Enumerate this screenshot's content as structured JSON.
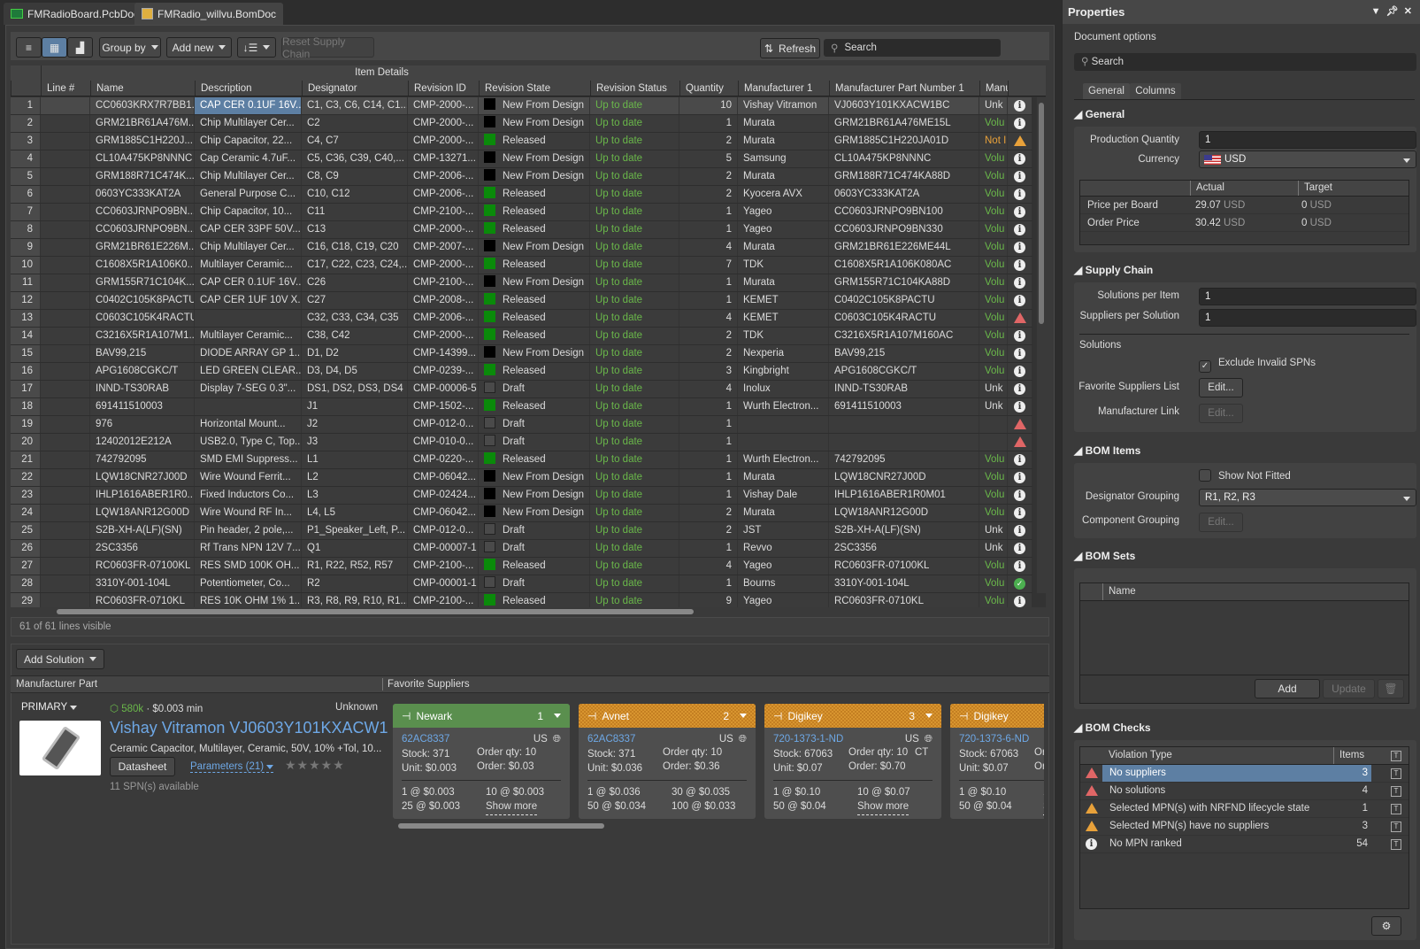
{
  "tabs": [
    {
      "label": "FMRadioBoard.PcbDoc",
      "icon": "pcb-icon"
    },
    {
      "label": "FMRadio_willvu.BomDoc",
      "icon": "bom-doc-icon"
    }
  ],
  "toolbar": {
    "group_by": "Group by",
    "add_new": "Add new",
    "reset_supply_chain": "Reset Supply Chain",
    "refresh": "Refresh",
    "search_placeholder": "Search"
  },
  "grid": {
    "group_header": "Item Details",
    "columns": [
      "",
      "Line #",
      "Name",
      "Description",
      "Designator",
      "Revision ID",
      "Revision State",
      "Revision Status",
      "Quantity",
      "Manufacturer 1",
      "Manufacturer Part Number 1",
      "Manu",
      ""
    ],
    "status_colors": {
      "new": "#000000",
      "released": "#0a8a0a",
      "draft": "#4a4a4a"
    },
    "rows": [
      {
        "n": "1",
        "name": "CC0603KRX7R7BB1...",
        "desc": "CAP CER 0.1UF 16V...",
        "des": "C1, C3, C6, C14, C1...",
        "rev": "CMP-2000-...",
        "state": "new",
        "state_label": "New From Design",
        "status": "Up to date",
        "qty": "10",
        "mfr": "Vishay Vitramon",
        "mpn": "VJ0603Y101KXACW1BC",
        "manu": "Unk",
        "manu_color": "#dddddd",
        "icon": "info"
      },
      {
        "n": "2",
        "name": "GRM21BR61A476M...",
        "desc": "Chip Multilayer Cer...",
        "des": "C2",
        "rev": "CMP-2000-...",
        "state": "new",
        "state_label": "New From Design",
        "status": "Up to date",
        "qty": "1",
        "mfr": "Murata",
        "mpn": "GRM21BR61A476ME15L",
        "manu": "Volu",
        "manu_color": "#6ab84a",
        "icon": "info"
      },
      {
        "n": "3",
        "name": "GRM1885C1H220J...",
        "desc": "Chip Capacitor, 22...",
        "des": "C4, C7",
        "rev": "CMP-2000-...",
        "state": "released",
        "state_label": "Released",
        "status": "Up to date",
        "qty": "2",
        "mfr": "Murata",
        "mpn": "GRM1885C1H220JA01D",
        "manu": "Not I",
        "manu_color": "#e8a13a",
        "icon": "warn-orange"
      },
      {
        "n": "4",
        "name": "CL10A475KP8NNNC",
        "desc": "Cap Ceramic 4.7uF...",
        "des": "C5, C36, C39, C40,...",
        "rev": "CMP-13271...",
        "state": "new",
        "state_label": "New From Design",
        "status": "Up to date",
        "qty": "5",
        "mfr": "Samsung",
        "mpn": "CL10A475KP8NNNC",
        "manu": "Volu",
        "manu_color": "#6ab84a",
        "icon": "info"
      },
      {
        "n": "5",
        "name": "GRM188R71C474K...",
        "desc": "Chip Multilayer Cer...",
        "des": "C8, C9",
        "rev": "CMP-2006-...",
        "state": "new",
        "state_label": "New From Design",
        "status": "Up to date",
        "qty": "2",
        "mfr": "Murata",
        "mpn": "GRM188R71C474KA88D",
        "manu": "Volu",
        "manu_color": "#6ab84a",
        "icon": "info"
      },
      {
        "n": "6",
        "name": "0603YC333KAT2A",
        "desc": "General Purpose C...",
        "des": "C10, C12",
        "rev": "CMP-2006-...",
        "state": "released",
        "state_label": "Released",
        "status": "Up to date",
        "qty": "2",
        "mfr": "Kyocera AVX",
        "mpn": "0603YC333KAT2A",
        "manu": "Volu",
        "manu_color": "#6ab84a",
        "icon": "info"
      },
      {
        "n": "7",
        "name": "CC0603JRNPO9BN...",
        "desc": "Chip Capacitor, 10...",
        "des": "C11",
        "rev": "CMP-2100-...",
        "state": "released",
        "state_label": "Released",
        "status": "Up to date",
        "qty": "1",
        "mfr": "Yageo",
        "mpn": "CC0603JRNPO9BN100",
        "manu": "Volu",
        "manu_color": "#6ab84a",
        "icon": "info"
      },
      {
        "n": "8",
        "name": "CC0603JRNPO9BN...",
        "desc": "CAP CER 33PF 50V...",
        "des": "C13",
        "rev": "CMP-2000-...",
        "state": "released",
        "state_label": "Released",
        "status": "Up to date",
        "qty": "1",
        "mfr": "Yageo",
        "mpn": "CC0603JRNPO9BN330",
        "manu": "Volu",
        "manu_color": "#6ab84a",
        "icon": "info"
      },
      {
        "n": "9",
        "name": "GRM21BR61E226M...",
        "desc": "Chip Multilayer Cer...",
        "des": "C16, C18, C19, C20",
        "rev": "CMP-2007-...",
        "state": "new",
        "state_label": "New From Design",
        "status": "Up to date",
        "qty": "4",
        "mfr": "Murata",
        "mpn": "GRM21BR61E226ME44L",
        "manu": "Volu",
        "manu_color": "#6ab84a",
        "icon": "info"
      },
      {
        "n": "10",
        "name": "C1608X5R1A106K0...",
        "desc": "Multilayer Ceramic...",
        "des": "C17, C22, C23, C24,...",
        "rev": "CMP-2000-...",
        "state": "released",
        "state_label": "Released",
        "status": "Up to date",
        "qty": "7",
        "mfr": "TDK",
        "mpn": "C1608X5R1A106K080AC",
        "manu": "Volu",
        "manu_color": "#6ab84a",
        "icon": "info"
      },
      {
        "n": "11",
        "name": "GRM155R71C104K...",
        "desc": "CAP CER 0.1UF 16V...",
        "des": "C26",
        "rev": "CMP-2100-...",
        "state": "new",
        "state_label": "New From Design",
        "status": "Up to date",
        "qty": "1",
        "mfr": "Murata",
        "mpn": "GRM155R71C104KA88D",
        "manu": "Volu",
        "manu_color": "#6ab84a",
        "icon": "info"
      },
      {
        "n": "12",
        "name": "C0402C105K8PACTU",
        "desc": "CAP CER 1UF 10V X...",
        "des": "C27",
        "rev": "CMP-2008-...",
        "state": "released",
        "state_label": "Released",
        "status": "Up to date",
        "qty": "1",
        "mfr": "KEMET",
        "mpn": "C0402C105K8PACTU",
        "manu": "Volu",
        "manu_color": "#6ab84a",
        "icon": "info"
      },
      {
        "n": "13",
        "name": "C0603C105K4RACTU",
        "desc": "",
        "des": "C32, C33, C34, C35",
        "rev": "CMP-2006-...",
        "state": "released",
        "state_label": "Released",
        "status": "Up to date",
        "qty": "4",
        "mfr": "KEMET",
        "mpn": "C0603C105K4RACTU",
        "manu": "Volu",
        "manu_color": "#6ab84a",
        "icon": "warn-red"
      },
      {
        "n": "14",
        "name": "C3216X5R1A107M1...",
        "desc": "Multilayer Ceramic...",
        "des": "C38, C42",
        "rev": "CMP-2000-...",
        "state": "released",
        "state_label": "Released",
        "status": "Up to date",
        "qty": "2",
        "mfr": "TDK",
        "mpn": "C3216X5R1A107M160AC",
        "manu": "Volu",
        "manu_color": "#6ab84a",
        "icon": "info"
      },
      {
        "n": "15",
        "name": "BAV99,215",
        "desc": "DIODE ARRAY GP 1...",
        "des": "D1, D2",
        "rev": "CMP-14399...",
        "state": "new",
        "state_label": "New From Design",
        "status": "Up to date",
        "qty": "2",
        "mfr": "Nexperia",
        "mpn": "BAV99,215",
        "manu": "Volu",
        "manu_color": "#6ab84a",
        "icon": "info"
      },
      {
        "n": "16",
        "name": "APG1608CGKC/T",
        "desc": "LED GREEN CLEAR...",
        "des": "D3, D4, D5",
        "rev": "CMP-0239-...",
        "state": "released",
        "state_label": "Released",
        "status": "Up to date",
        "qty": "3",
        "mfr": "Kingbright",
        "mpn": "APG1608CGKC/T",
        "manu": "Volu",
        "manu_color": "#6ab84a",
        "icon": "info"
      },
      {
        "n": "17",
        "name": "INND-TS30RAB",
        "desc": "Display 7-SEG 0.3\"...",
        "des": "DS1, DS2, DS3, DS4",
        "rev": "CMP-00006-5",
        "state": "draft",
        "state_label": "Draft",
        "status": "Up to date",
        "qty": "4",
        "mfr": "Inolux",
        "mpn": "INND-TS30RAB",
        "manu": "Unk",
        "manu_color": "#dddddd",
        "icon": "info"
      },
      {
        "n": "18",
        "name": "691411510003",
        "desc": "",
        "des": "J1",
        "rev": "CMP-1502-...",
        "state": "released",
        "state_label": "Released",
        "status": "Up to date",
        "qty": "1",
        "mfr": "Wurth Electron...",
        "mpn": "691411510003",
        "manu": "Unk",
        "manu_color": "#dddddd",
        "icon": "info"
      },
      {
        "n": "19",
        "name": "976",
        "desc": "Horizontal Mount...",
        "des": "J2",
        "rev": "CMP-012-0...",
        "state": "draft",
        "state_label": "Draft",
        "status": "Up to date",
        "qty": "1",
        "mfr": "",
        "mpn": "",
        "manu": "",
        "manu_color": "#dddddd",
        "icon": "warn-red"
      },
      {
        "n": "20",
        "name": "12402012E212A",
        "desc": "USB2.0, Type C, Top...",
        "des": "J3",
        "rev": "CMP-010-0...",
        "state": "draft",
        "state_label": "Draft",
        "status": "Up to date",
        "qty": "1",
        "mfr": "",
        "mpn": "",
        "manu": "",
        "manu_color": "#dddddd",
        "icon": "warn-red"
      },
      {
        "n": "21",
        "name": "742792095",
        "desc": "SMD EMI Suppress...",
        "des": "L1",
        "rev": "CMP-0220-...",
        "state": "released",
        "state_label": "Released",
        "status": "Up to date",
        "qty": "1",
        "mfr": "Wurth Electron...",
        "mpn": "742792095",
        "manu": "Volu",
        "manu_color": "#6ab84a",
        "icon": "info"
      },
      {
        "n": "22",
        "name": "LQW18CNR27J00D",
        "desc": "Wire Wound Ferrit...",
        "des": "L2",
        "rev": "CMP-06042...",
        "state": "new",
        "state_label": "New From Design",
        "status": "Up to date",
        "qty": "1",
        "mfr": "Murata",
        "mpn": "LQW18CNR27J00D",
        "manu": "Volu",
        "manu_color": "#6ab84a",
        "icon": "info"
      },
      {
        "n": "23",
        "name": "IHLP1616ABER1R0...",
        "desc": "Fixed Inductors Co...",
        "des": "L3",
        "rev": "CMP-02424...",
        "state": "new",
        "state_label": "New From Design",
        "status": "Up to date",
        "qty": "1",
        "mfr": "Vishay Dale",
        "mpn": "IHLP1616ABER1R0M01",
        "manu": "Volu",
        "manu_color": "#6ab84a",
        "icon": "info"
      },
      {
        "n": "24",
        "name": "LQW18ANR12G00D",
        "desc": "Wire Wound RF In...",
        "des": "L4, L5",
        "rev": "CMP-06042...",
        "state": "new",
        "state_label": "New From Design",
        "status": "Up to date",
        "qty": "2",
        "mfr": "Murata",
        "mpn": "LQW18ANR12G00D",
        "manu": "Volu",
        "manu_color": "#6ab84a",
        "icon": "info"
      },
      {
        "n": "25",
        "name": "S2B-XH-A(LF)(SN)",
        "desc": "Pin header, 2 pole,...",
        "des": "P1_Speaker_Left, P...",
        "rev": "CMP-012-0...",
        "state": "draft",
        "state_label": "Draft",
        "status": "Up to date",
        "qty": "2",
        "mfr": "JST",
        "mpn": "S2B-XH-A(LF)(SN)",
        "manu": "Unk",
        "manu_color": "#dddddd",
        "icon": "info"
      },
      {
        "n": "26",
        "name": "2SC3356",
        "desc": "Rf Trans NPN 12V 7...",
        "des": "Q1",
        "rev": "CMP-00007-1",
        "state": "draft",
        "state_label": "Draft",
        "status": "Up to date",
        "qty": "1",
        "mfr": "Revvo",
        "mpn": "2SC3356",
        "manu": "Unk",
        "manu_color": "#dddddd",
        "icon": "info"
      },
      {
        "n": "27",
        "name": "RC0603FR-07100KL",
        "desc": "RES SMD 100K OH...",
        "des": "R1, R22, R52, R57",
        "rev": "CMP-2100-...",
        "state": "released",
        "state_label": "Released",
        "status": "Up to date",
        "qty": "4",
        "mfr": "Yageo",
        "mpn": "RC0603FR-07100KL",
        "manu": "Volu",
        "manu_color": "#6ab84a",
        "icon": "info"
      },
      {
        "n": "28",
        "name": "3310Y-001-104L",
        "desc": "Potentiometer, Co...",
        "des": "R2",
        "rev": "CMP-00001-1",
        "state": "draft",
        "state_label": "Draft",
        "status": "Up to date",
        "qty": "1",
        "mfr": "Bourns",
        "mpn": "3310Y-001-104L",
        "manu": "Volu",
        "manu_color": "#6ab84a",
        "icon": "ok"
      },
      {
        "n": "29",
        "name": "RC0603FR-0710KL",
        "desc": "RES 10K OHM 1% 1...",
        "des": "R3, R8, R9, R10, R1...",
        "rev": "CMP-2100-...",
        "state": "released",
        "state_label": "Released",
        "status": "Up to date",
        "qty": "9",
        "mfr": "Yageo",
        "mpn": "RC0603FR-0710KL",
        "manu": "Volu",
        "manu_color": "#6ab84a",
        "icon": "info"
      }
    ],
    "footer": "61 of 61 lines visible"
  },
  "solution": {
    "add_solution": "Add Solution",
    "mfr_part_header": "Manufacturer Part",
    "fav_suppliers_header": "Favorite Suppliers",
    "primary": "PRIMARY",
    "stock_summary": "580k",
    "price_summary": " · $0.003 min",
    "lifecycle": "Unknown",
    "title": "Vishay Vitramon VJ0603Y101KXACW1",
    "description": "Ceramic Capacitor, Multilayer, Ceramic, 50V, 10% +Tol, 10...",
    "datasheet": "Datasheet",
    "parameters": "Parameters (21)",
    "stars": "★★★★★",
    "spn_available": "11 SPN(s) available"
  },
  "suppliers": [
    {
      "name": "Newark",
      "rank": "1",
      "style": "green",
      "spn": "62AC8337",
      "country": "US",
      "stock": "Stock: 371",
      "unit": "Unit: $0.003",
      "order_qty": "Order qty: 10",
      "order": "Order: $0.03",
      "extra": "",
      "breaks": [
        "1 @ $0.003",
        "10 @ $0.003",
        "25 @ $0.003"
      ],
      "show_more": "Show more"
    },
    {
      "name": "Avnet",
      "rank": "2",
      "style": "orange",
      "spn": "62AC8337",
      "country": "US",
      "stock": "Stock: 371",
      "unit": "Unit: $0.036",
      "order_qty": "Order qty: 10",
      "order": "Order: $0.36",
      "extra": "",
      "breaks": [
        "1 @ $0.036",
        "30 @ $0.035",
        "50 @ $0.034",
        "100 @ $0.033"
      ],
      "show_more": ""
    },
    {
      "name": "Digikey",
      "rank": "3",
      "style": "orange",
      "spn": "720-1373-1-ND",
      "country": "US",
      "stock": "Stock: 67063",
      "unit": "Unit: $0.07",
      "order_qty": "Order qty: 10",
      "order": "Order: $0.70",
      "extra": "CT",
      "breaks": [
        "1 @ $0.10",
        "10 @ $0.07",
        "50 @ $0.04"
      ],
      "show_more": "Show more"
    },
    {
      "name": "Digikey",
      "rank": "",
      "style": "orange",
      "spn": "720-1373-6-ND",
      "country": "",
      "stock": "Stock: 67063",
      "unit": "Unit: $0.07",
      "order_qty": "Ord",
      "order": "Ord",
      "extra": "",
      "breaks": [
        "1 @ $0.10",
        "10",
        "50 @ $0.04"
      ],
      "show_more": "S"
    }
  ],
  "properties": {
    "title": "Properties",
    "document_options": "Document options",
    "search_placeholder": "Search",
    "tabs": [
      "General",
      "Columns"
    ],
    "general": {
      "header": "General",
      "production_quantity_label": "Production Quantity",
      "production_quantity": "1",
      "currency_label": "Currency",
      "currency": "USD",
      "price_cols": [
        "Actual",
        "Target"
      ],
      "price_rows": [
        {
          "label": "Price per Board",
          "actual": "29.07",
          "target": "0",
          "unit": "USD"
        },
        {
          "label": "Order Price",
          "actual": "30.42",
          "target": "0",
          "unit": "USD"
        }
      ]
    },
    "supply_chain": {
      "header": "Supply Chain",
      "solutions_per_item_label": "Solutions per Item",
      "solutions_per_item": "1",
      "suppliers_per_solution_label": "Suppliers per Solution",
      "suppliers_per_solution": "1",
      "solutions_label": "Solutions",
      "exclude_invalid": "Exclude Invalid SPNs",
      "exclude_invalid_checked": true,
      "fav_list_label": "Favorite Suppliers List",
      "mfr_link_label": "Manufacturer Link",
      "edit": "Edit..."
    },
    "bom_items": {
      "header": "BOM Items",
      "show_not_fitted": "Show Not Fitted",
      "show_not_fitted_checked": false,
      "designator_grouping_label": "Designator Grouping",
      "designator_grouping": "R1, R2, R3",
      "component_grouping_label": "Component Grouping",
      "edit": "Edit..."
    },
    "bom_sets": {
      "header": "BOM Sets",
      "name_col": "Name",
      "add": "Add",
      "update": "Update"
    },
    "bom_checks": {
      "header": "BOM Checks",
      "violation_col": "Violation Type",
      "items_col": "Items",
      "rows": [
        {
          "icon": "warn-red",
          "label": "No suppliers",
          "count": "3"
        },
        {
          "icon": "warn-red",
          "label": "No solutions",
          "count": "4"
        },
        {
          "icon": "warn-orange",
          "label": "Selected MPN(s) with NRFND lifecycle state",
          "count": "1"
        },
        {
          "icon": "warn-orange",
          "label": "Selected MPN(s) have no suppliers",
          "count": "3"
        },
        {
          "icon": "info",
          "label": "No MPN ranked",
          "count": "54"
        }
      ]
    }
  }
}
